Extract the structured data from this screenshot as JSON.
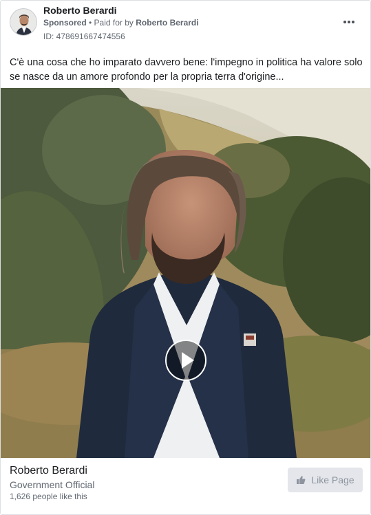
{
  "post": {
    "author_name": "Roberto Berardi",
    "sponsored_label": "Sponsored",
    "separator": " • ",
    "paid_prefix": "Paid for by ",
    "paid_by": "Roberto Berardi",
    "ad_id": "ID: 478691667474556",
    "more_icon": "more-options-icon",
    "text": "C'è una cosa che ho imparato davvero bene: l'impegno in politica ha valore solo se nasce da un amore profondo per la propria terra d'origine..."
  },
  "media": {
    "type": "video",
    "play_icon": "play-icon"
  },
  "footer": {
    "page_name": "Roberto Berardi",
    "category": "Government Official",
    "likes_text": "1,626 people like this",
    "like_button_label": "Like Page",
    "like_icon": "thumbs-up-icon"
  },
  "colors": {
    "text_primary": "#1c1e21",
    "text_secondary": "#606770",
    "button_bg": "#e4e6eb",
    "button_text": "#8d949e",
    "border": "#dddfe2"
  }
}
